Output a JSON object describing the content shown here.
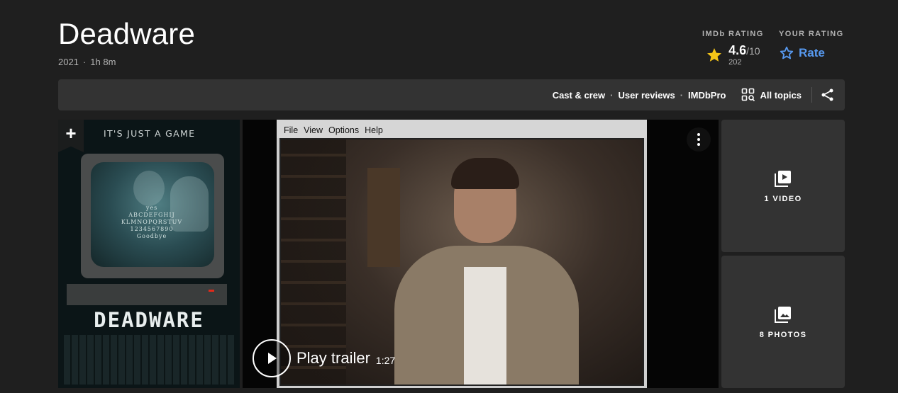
{
  "title": "Deadware",
  "meta": {
    "year": "2021",
    "dot": "·",
    "runtime": "1h 8m"
  },
  "imdb_rating": {
    "label": "IMDb RATING",
    "score": "4.6",
    "max": "/10",
    "votes": "202",
    "icon": "star-icon",
    "icon_color": "#f5c518"
  },
  "your_rating": {
    "label": "YOUR RATING",
    "action": "Rate",
    "icon": "star-outline-icon",
    "color": "#5799ef"
  },
  "subnav": {
    "links": [
      "Cast & crew",
      "User reviews",
      "IMDbPro"
    ],
    "sep": "·",
    "all_topics": "All topics",
    "share_icon": "share-icon"
  },
  "poster": {
    "tagline": "IT'S JUST A GAME",
    "board_line1": "yes",
    "board_line2": "ABCDEFGHIJ",
    "board_line3": "KLMNOPQRSTUV",
    "board_line4": "1234567890",
    "board_line5": "Goodbye",
    "title": "DEADWARE",
    "add_glyph": "+"
  },
  "video": {
    "menu": [
      "File",
      "View",
      "Options",
      "Help"
    ],
    "play_label": "Play trailer",
    "duration": "1:27"
  },
  "tiles": {
    "videos": "1 VIDEO",
    "photos": "8 PHOTOS"
  }
}
